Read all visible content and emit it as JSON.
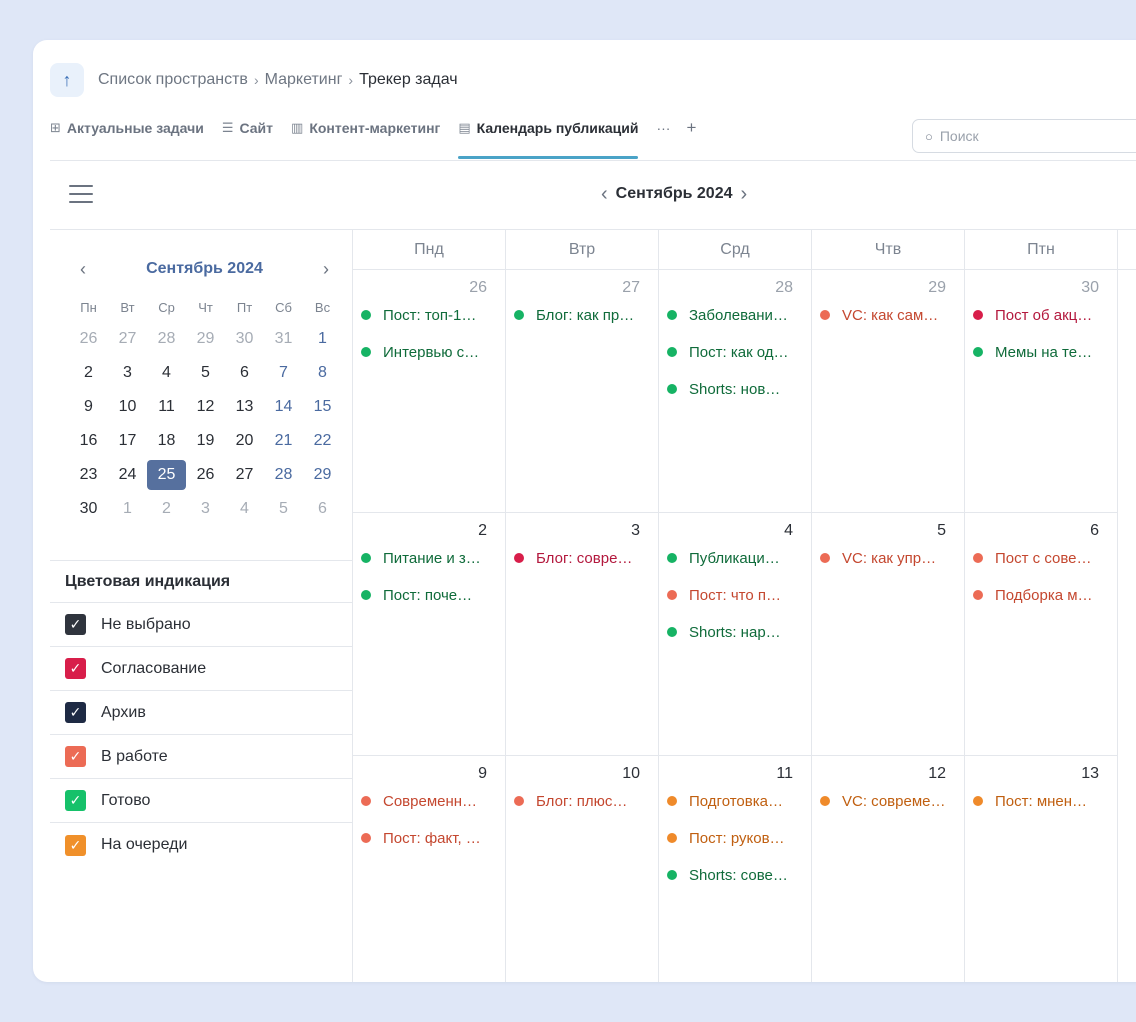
{
  "breadcrumb": {
    "up_icon": "arrow-up-icon",
    "items": [
      "Список пространств",
      "Маркетинг",
      "Трекер задач"
    ],
    "separator": "›"
  },
  "tabs": [
    {
      "icon": "table-icon",
      "glyph": "⊞",
      "label": "Актуальные задачи",
      "active": false
    },
    {
      "icon": "list-icon",
      "glyph": "☰",
      "label": "Сайт",
      "active": false
    },
    {
      "icon": "kanban-icon",
      "glyph": "▥",
      "label": "Контент-маркетинг",
      "active": false
    },
    {
      "icon": "calendar-doc-icon",
      "glyph": "▤",
      "label": "Календарь публикаций",
      "active": true
    }
  ],
  "tabs_more": "···",
  "tabs_add": "+",
  "search": {
    "placeholder": "Поиск",
    "value": ""
  },
  "toolbar": {
    "month_title": "Сентябрь 2024",
    "prev": "‹",
    "next": "›"
  },
  "mini_calendar": {
    "title": "Сентябрь 2024",
    "prev": "‹",
    "next": "›",
    "weekdays": [
      "Пн",
      "Вт",
      "Ср",
      "Чт",
      "Пт",
      "Сб",
      "Вс"
    ],
    "weeks": [
      [
        "26",
        "27",
        "28",
        "29",
        "30",
        "31",
        "1"
      ],
      [
        "2",
        "3",
        "4",
        "5",
        "6",
        "7",
        "8"
      ],
      [
        "9",
        "10",
        "11",
        "12",
        "13",
        "14",
        "15"
      ],
      [
        "16",
        "17",
        "18",
        "19",
        "20",
        "21",
        "22"
      ],
      [
        "23",
        "24",
        "25",
        "26",
        "27",
        "28",
        "29"
      ],
      [
        "30",
        "1",
        "2",
        "3",
        "4",
        "5",
        "6"
      ]
    ],
    "today": "25"
  },
  "legend": {
    "title": "Цветовая индикация",
    "items": [
      {
        "label": "Не выбрано",
        "color": "#2f343d"
      },
      {
        "label": "Согласование",
        "color": "#d81e4a"
      },
      {
        "label": "Архив",
        "color": "#1e2a44"
      },
      {
        "label": "В работе",
        "color": "#ec6b55"
      },
      {
        "label": "Готово",
        "color": "#16c16a"
      },
      {
        "label": "На очереди",
        "color": "#f0902a"
      }
    ]
  },
  "status_colors": {
    "green": "#16b364",
    "green_text": "#0f6b3a",
    "red": "#d81e4a",
    "red_text": "#b3183d",
    "orange": "#ec6b55",
    "orange_text": "#c4472f",
    "amber": "#ef8a2a",
    "amber_text": "#c05f10"
  },
  "calendar": {
    "weekdays": [
      "Пнд",
      "Втр",
      "Срд",
      "Чтв",
      "Птн"
    ],
    "weeks": [
      [
        {
          "day": "26",
          "muted": true,
          "events": [
            {
              "text": "Пост: топ-1…",
              "status": "green"
            },
            {
              "text": "Интервью с…",
              "status": "green"
            }
          ]
        },
        {
          "day": "27",
          "muted": true,
          "events": [
            {
              "text": "Блог: как пр…",
              "status": "green"
            }
          ]
        },
        {
          "day": "28",
          "muted": true,
          "events": [
            {
              "text": "Заболевани…",
              "status": "green"
            },
            {
              "text": "Пост: как од…",
              "status": "green"
            },
            {
              "text": "Shorts: нов…",
              "status": "green"
            }
          ]
        },
        {
          "day": "29",
          "muted": true,
          "events": [
            {
              "text": "VC: как сам…",
              "status": "orange"
            }
          ]
        },
        {
          "day": "30",
          "muted": true,
          "events": [
            {
              "text": "Пост об акц…",
              "status": "red"
            },
            {
              "text": "Мемы на те…",
              "status": "green"
            }
          ]
        }
      ],
      [
        {
          "day": "2",
          "muted": false,
          "events": [
            {
              "text": "Питание и з…",
              "status": "green"
            },
            {
              "text": "Пост: поче…",
              "status": "green"
            }
          ]
        },
        {
          "day": "3",
          "muted": false,
          "events": [
            {
              "text": "Блог: совре…",
              "status": "red"
            }
          ]
        },
        {
          "day": "4",
          "muted": false,
          "events": [
            {
              "text": "Публикаци…",
              "status": "green"
            },
            {
              "text": "Пост: что п…",
              "status": "orange"
            },
            {
              "text": "Shorts: нар…",
              "status": "green"
            }
          ]
        },
        {
          "day": "5",
          "muted": false,
          "events": [
            {
              "text": "VC: как упр…",
              "status": "orange"
            }
          ]
        },
        {
          "day": "6",
          "muted": false,
          "events": [
            {
              "text": "Пост с сове…",
              "status": "orange"
            },
            {
              "text": "Подборка м…",
              "status": "orange"
            }
          ]
        }
      ],
      [
        {
          "day": "9",
          "muted": false,
          "events": [
            {
              "text": "Современн…",
              "status": "orange"
            },
            {
              "text": "Пост: факт, …",
              "status": "orange"
            }
          ]
        },
        {
          "day": "10",
          "muted": false,
          "events": [
            {
              "text": "Блог: плюс…",
              "status": "orange"
            }
          ]
        },
        {
          "day": "11",
          "muted": false,
          "events": [
            {
              "text": "Подготовка…",
              "status": "amber"
            },
            {
              "text": "Пост: руков…",
              "status": "amber"
            },
            {
              "text": "Shorts: сове…",
              "status": "green"
            }
          ]
        },
        {
          "day": "12",
          "muted": false,
          "events": [
            {
              "text": "VC: совреме…",
              "status": "amber"
            }
          ]
        },
        {
          "day": "13",
          "muted": false,
          "events": [
            {
              "text": "Пост: мнен…",
              "status": "amber"
            }
          ]
        }
      ]
    ]
  }
}
